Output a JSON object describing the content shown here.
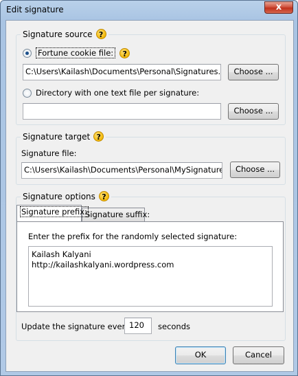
{
  "window": {
    "title": "Edit signature",
    "close_glyph": "x"
  },
  "source": {
    "title": "Signature source",
    "help_glyph": "?",
    "fortune_label": "Fortune cookie file:",
    "fortune_path": "C:\\Users\\Kailash\\Documents\\Personal\\Signatures.txt",
    "fortune_choose": "Choose ...",
    "directory_label": "Directory with one text file per signature:",
    "directory_path": "",
    "directory_choose": "Choose ..."
  },
  "target": {
    "title": "Signature target",
    "file_label": "Signature file:",
    "file_path": "C:\\Users\\Kailash\\Documents\\Personal\\MySignature.txt",
    "choose": "Choose ..."
  },
  "options": {
    "title": "Signature options",
    "tabs": [
      {
        "label": "Signature prefix:",
        "active": true
      },
      {
        "label": "Signature suffix:",
        "active": false
      }
    ],
    "prefix_instruction": "Enter the prefix for the randomly selected signature:",
    "prefix_line1": "Kailash Kalyani",
    "prefix_line2": "http://kailashkalyani.wordpress.com"
  },
  "update": {
    "label_before": "Update the signature every",
    "value": "120",
    "label_after": "seconds"
  },
  "footer": {
    "ok": "OK",
    "cancel": "Cancel"
  }
}
